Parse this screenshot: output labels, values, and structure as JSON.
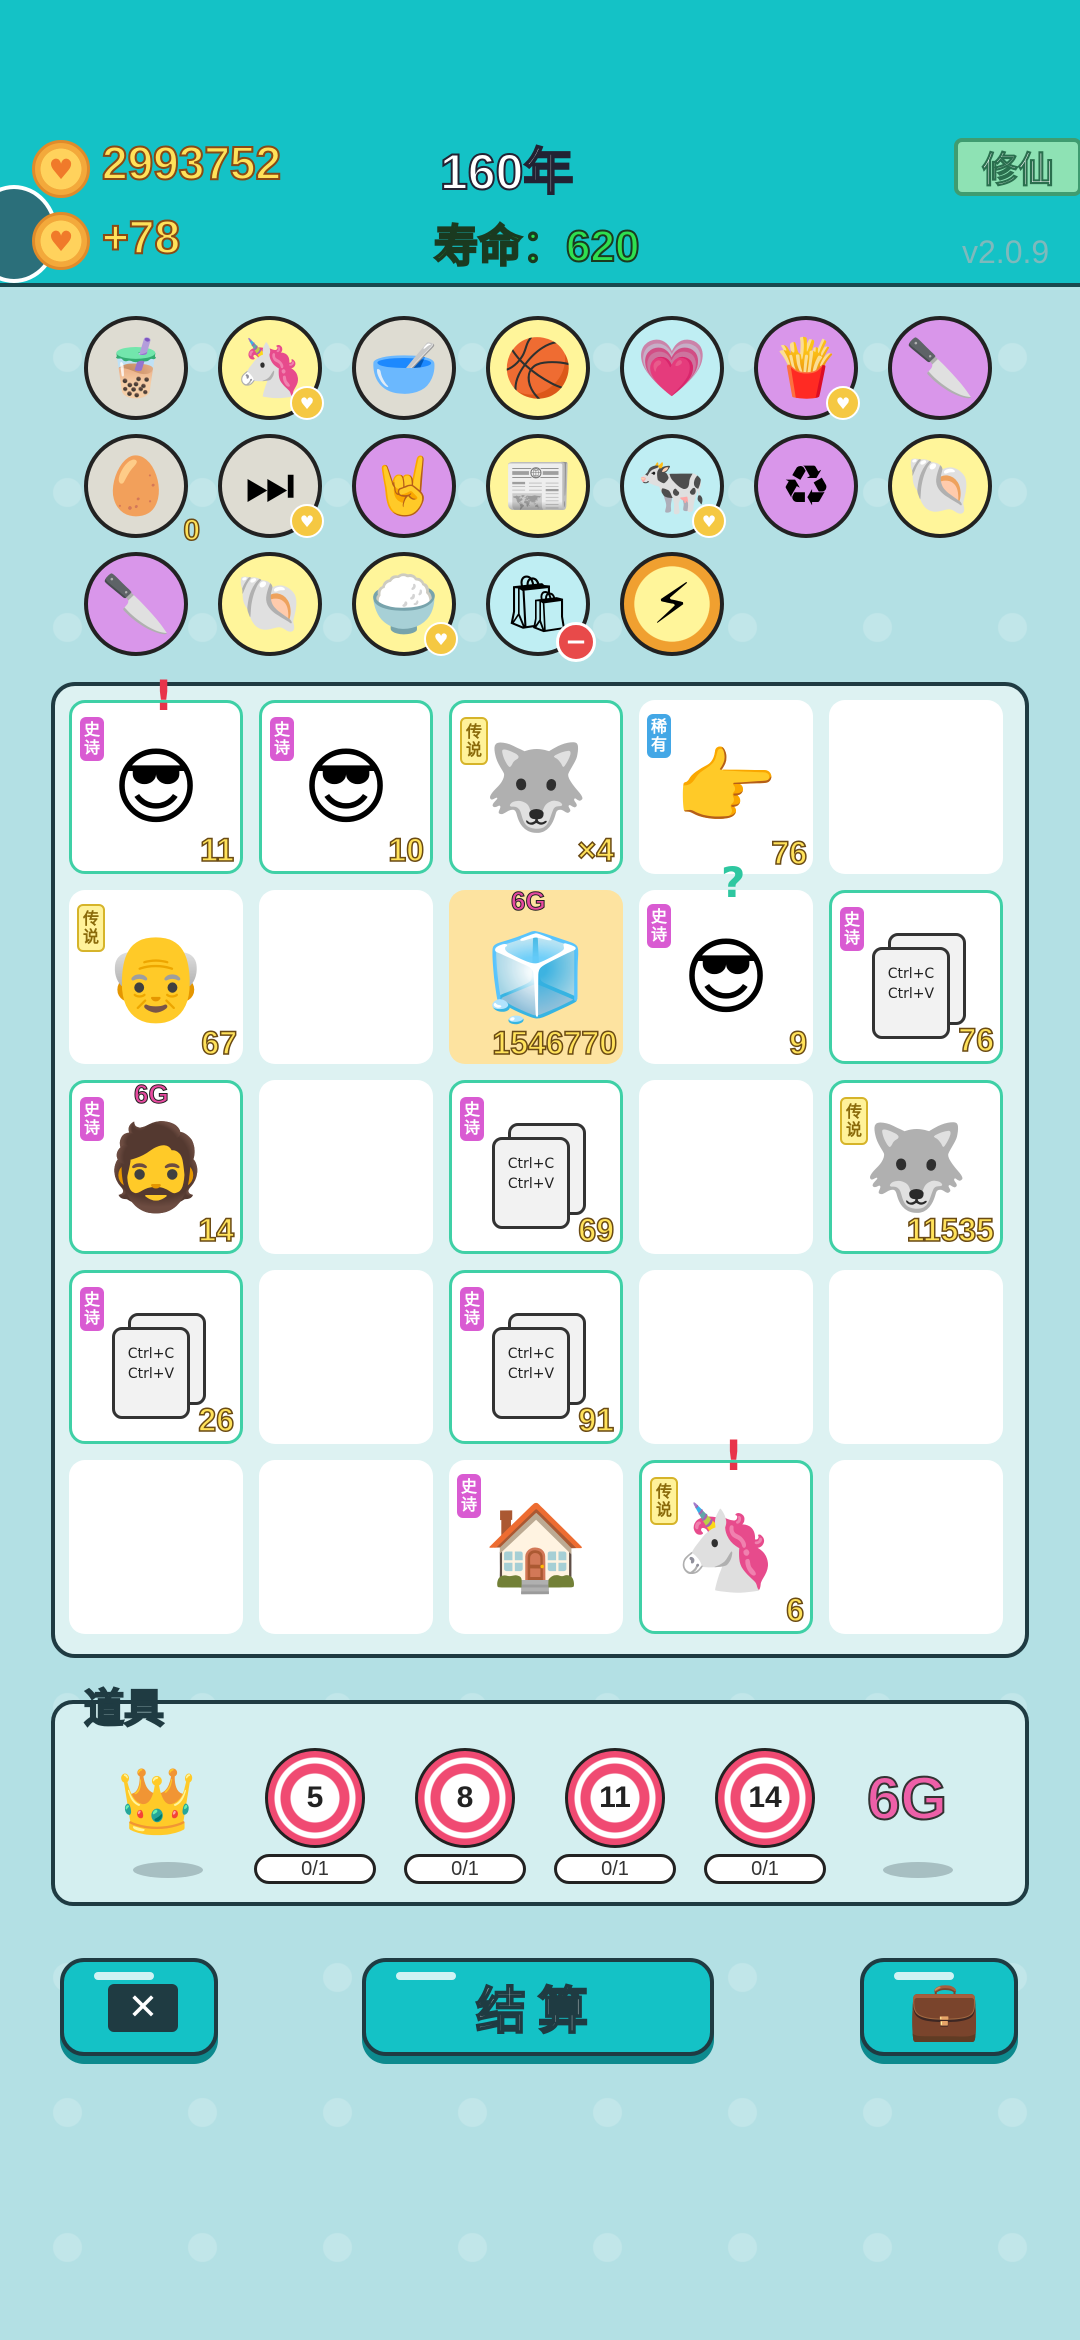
{
  "header": {
    "coins": "2993752",
    "income": "+78",
    "year": "160年",
    "lifespan": "寿命：620",
    "cultivate_label": "修仙",
    "version": "v2.0.9",
    "coin_icon": "heart-coin-icon"
  },
  "items": [
    {
      "name": "bubble-tea-icon",
      "glyph": "🧋",
      "bg": "#dedcd2"
    },
    {
      "name": "unicorn-icon",
      "glyph": "🦄",
      "bg": "#fff59a",
      "badge": true
    },
    {
      "name": "pet-food-bowl-icon",
      "glyph": "🥣",
      "bg": "#dedcd2"
    },
    {
      "name": "basketballs-icon",
      "glyph": "🏀",
      "bg": "#fff59a"
    },
    {
      "name": "heart-potion-icon",
      "glyph": "💗",
      "bg": "#bfeef3"
    },
    {
      "name": "french-fries-icon",
      "glyph": "🍟",
      "bg": "#d996ea",
      "badge": true
    },
    {
      "name": "cleaver-icon",
      "glyph": "🔪",
      "bg": "#d996ea"
    },
    {
      "name": "egg-tray-icon",
      "glyph": "🥚",
      "bg": "#dedcd2",
      "zero": "0"
    },
    {
      "name": "skip-forward-icon",
      "glyph": "⏭",
      "bg": "#dedcd2",
      "badge": true
    },
    {
      "name": "rock-hand-icon",
      "glyph": "🤘",
      "bg": "#d996ea"
    },
    {
      "name": "time-magazine-icon",
      "glyph": "📰",
      "bg": "#fff59a"
    },
    {
      "name": "cow-pair-icon",
      "glyph": "🐄",
      "bg": "#bfeef3",
      "badge": true
    },
    {
      "name": "recycle-icon",
      "glyph": "♻",
      "bg": "#d996ea"
    },
    {
      "name": "seashell-icon",
      "glyph": "🐚",
      "bg": "#fff59a"
    },
    {
      "name": "cleaver-icon-2",
      "glyph": "🔪",
      "bg": "#d996ea"
    },
    {
      "name": "seashell-icon-2",
      "glyph": "🐚",
      "bg": "#fff59a"
    },
    {
      "name": "rice-bowl-icon",
      "glyph": "🍚",
      "bg": "#fff59a",
      "badge": true
    },
    {
      "name": "garbage-bag-icon",
      "glyph": "🛍",
      "bg": "#bfeef3",
      "minus": true
    },
    {
      "name": "lightning-icon",
      "glyph": "⚡",
      "bg": "#fff59a"
    }
  ],
  "board": [
    [
      {
        "tag": "史诗",
        "tagType": "epic",
        "glyph": "😎",
        "name": "green-hair-guy-icon",
        "count": "11",
        "hl": true,
        "mark": "!",
        "markColor": "#e8344a"
      },
      {
        "tag": "史诗",
        "tagType": "epic",
        "glyph": "😎",
        "name": "green-hair-guy-icon",
        "count": "10",
        "hl": true
      },
      {
        "tag": "传说",
        "tagType": "legend",
        "glyph": "🐺",
        "name": "husky-king-icon",
        "count": "×4",
        "hl": true
      },
      {
        "tag": "稀有",
        "tagType": "rare",
        "glyph": "👉",
        "name": "pointing-hand-icon",
        "count": "76"
      },
      {}
    ],
    [
      {
        "tag": "传说",
        "tagType": "legend",
        "glyph": "👴",
        "name": "bald-old-man-icon",
        "count": "67"
      },
      {},
      {
        "glyph": "🧊",
        "name": "smiling-fridge-icon",
        "count": "1546770",
        "gold": true,
        "sixg": "6G"
      },
      {
        "tag": "史诗",
        "tagType": "epic",
        "glyph": "😎",
        "name": "green-hair-guy-icon",
        "count": "9",
        "mark": "?",
        "markColor": "#2ec7a0"
      },
      {
        "tag": "史诗",
        "tagType": "epic",
        "clip": true,
        "name": "copy-paste-card-icon",
        "count": "76",
        "hl": true
      }
    ],
    [
      {
        "tag": "史诗",
        "tagType": "epic",
        "glyph": "🧔",
        "name": "bearded-man-icon",
        "count": "14",
        "hl": true,
        "sixg": "6G"
      },
      {},
      {
        "tag": "史诗",
        "tagType": "epic",
        "clip": true,
        "name": "copy-paste-card-icon",
        "count": "69",
        "hl": true
      },
      {},
      {
        "tag": "传说",
        "tagType": "legend",
        "glyph": "🐺",
        "name": "husky-king-icon",
        "count": "11535",
        "hl": true
      }
    ],
    [
      {
        "tag": "史诗",
        "tagType": "epic",
        "clip": true,
        "name": "copy-paste-card-icon",
        "count": "26",
        "hl": true
      },
      {},
      {
        "tag": "史诗",
        "tagType": "epic",
        "clip": true,
        "name": "copy-paste-card-icon",
        "count": "91",
        "hl": true
      },
      {},
      {}
    ],
    [
      {},
      {},
      {
        "tag": "史诗",
        "tagType": "epic",
        "glyph": "🏠",
        "name": "rabbit-house-icon"
      },
      {
        "tag": "传说",
        "tagType": "legend",
        "glyph": "🦄",
        "name": "unicorn-icon",
        "count": "6",
        "hl": true,
        "mark": "!",
        "markColor": "#e8344a"
      },
      {}
    ]
  ],
  "clip_text": "Ctrl+C\nCtrl+V",
  "props": {
    "label": "道具",
    "crown_icon": "crown-icon",
    "targets": [
      {
        "value": "5",
        "progress": "0/1"
      },
      {
        "value": "8",
        "progress": "0/1"
      },
      {
        "value": "11",
        "progress": "0/1"
      },
      {
        "value": "14",
        "progress": "0/1"
      }
    ],
    "sixg": "6G"
  },
  "buttons": {
    "settle_label": "结算",
    "close_icon": "close-icon",
    "bag_icon": "briefcase-icon"
  }
}
